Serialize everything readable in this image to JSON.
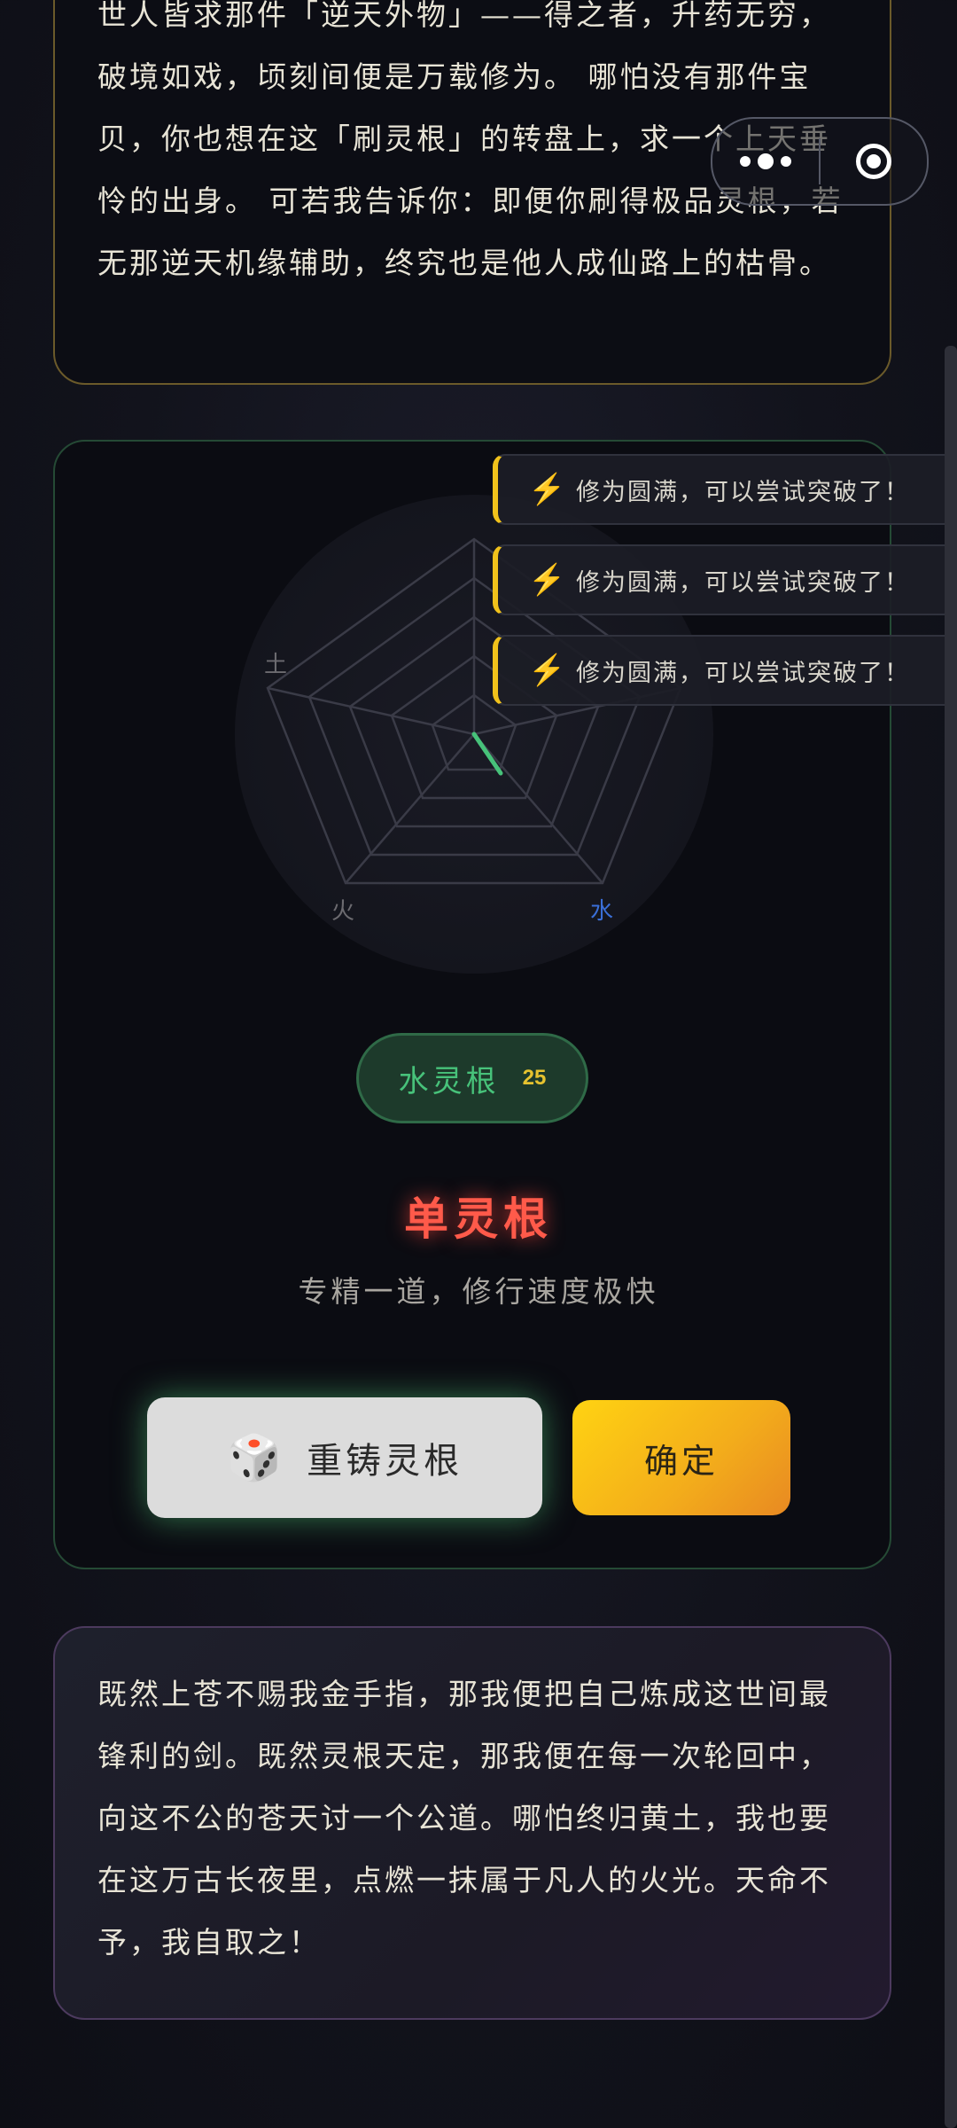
{
  "story_top": {
    "text": "世人皆求那件「逆天外物」——得之者，升药无穷，破境如戏，顷刻间便是万载修为。 哪怕没有那件宝贝，你也想在这「刷灵根」的转盘上，求一个上天垂怜的出身。 可若我告诉你：即便你刷得极品灵根，若无那逆天机缘辅助，终究也是他人成仙路上的枯骨。"
  },
  "mini_program": {
    "more_icon": "more-dots-icon",
    "close_icon": "target-close-icon"
  },
  "radar": {
    "labels": [
      "土",
      "火",
      "水"
    ],
    "accent": "#47c27a",
    "water_color": "#3a6fd8"
  },
  "toasts": [
    {
      "icon": "lightning-icon",
      "text": "修为圆满，可以尝试突破了！"
    },
    {
      "icon": "lightning-icon",
      "text": "修为圆满，可以尝试突破了！"
    },
    {
      "icon": "lightning-icon",
      "text": "修为圆满，可以尝试突破了！"
    }
  ],
  "spirit_root": {
    "name": "水灵根",
    "value": "25"
  },
  "result": {
    "title": "单灵根",
    "description": "专精一道，修行速度极快"
  },
  "buttons": {
    "recast_icon": "dice-icon",
    "recast_label": "重铸灵根",
    "confirm_label": "确定"
  },
  "story_bottom": {
    "text": "既然上苍不赐我金手指，那我便把自己炼成这世间最锋利的剑。既然灵根天定，那我便在每一次轮回中，向这不公的苍天讨一个公道。哪怕终归黄土，我也要在这万古长夜里，点燃一抹属于凡人的火光。天命不予，我自取之！"
  },
  "colors": {
    "gold": "#f1c21b",
    "red": "#ff5a4a",
    "green": "#47c27a"
  }
}
